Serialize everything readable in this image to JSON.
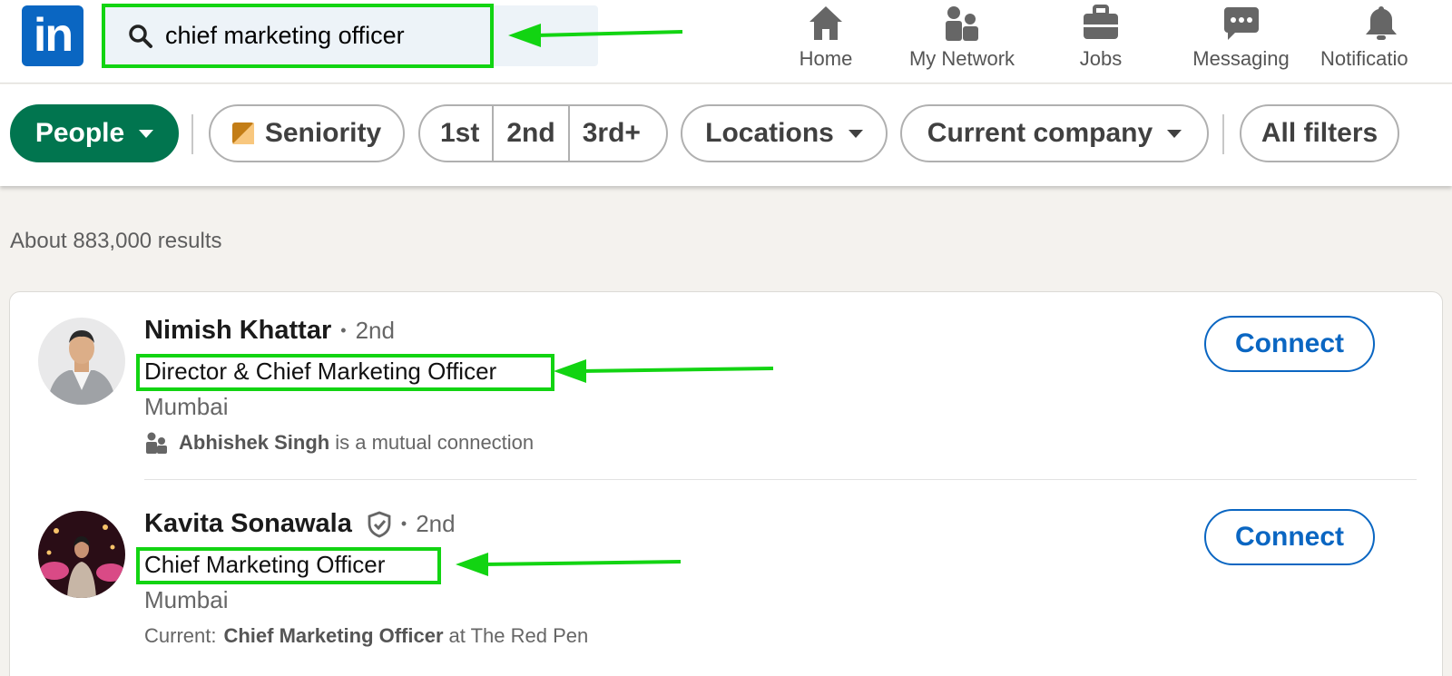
{
  "nav": {
    "logo_text": "in",
    "search_value": "chief marketing officer",
    "items": [
      {
        "label": "Home",
        "icon": "home-icon"
      },
      {
        "label": "My Network",
        "icon": "people-icon"
      },
      {
        "label": "Jobs",
        "icon": "briefcase-icon"
      },
      {
        "label": "Messaging",
        "icon": "chat-icon"
      },
      {
        "label": "Notificatio",
        "icon": "bell-icon"
      }
    ]
  },
  "filters": {
    "people": "People",
    "seniority": "Seniority",
    "degrees": [
      "1st",
      "2nd",
      "3rd+"
    ],
    "locations": "Locations",
    "current_company": "Current company",
    "all_filters": "All filters"
  },
  "results_count": "About 883,000 results",
  "results": [
    {
      "name": "Nimish Khattar",
      "dot": "•",
      "degree": "2nd",
      "headline": "Director & Chief Marketing Officer",
      "location": "Mumbai",
      "insight_bold": "Abhishek Singh",
      "insight_text": "is a mutual connection",
      "connect": "Connect"
    },
    {
      "name": "Kavita Sonawala",
      "dot": "•",
      "degree": "2nd",
      "headline": "Chief Marketing Officer",
      "location": "Mumbai",
      "insight_prefix": "Current:",
      "insight_bold": "Chief Marketing Officer",
      "insight_text": "at The Red Pen",
      "connect": "Connect"
    }
  ],
  "colors": {
    "brand": "#0a66c2",
    "people_pill": "#01754f",
    "annotation": "#12d412"
  }
}
